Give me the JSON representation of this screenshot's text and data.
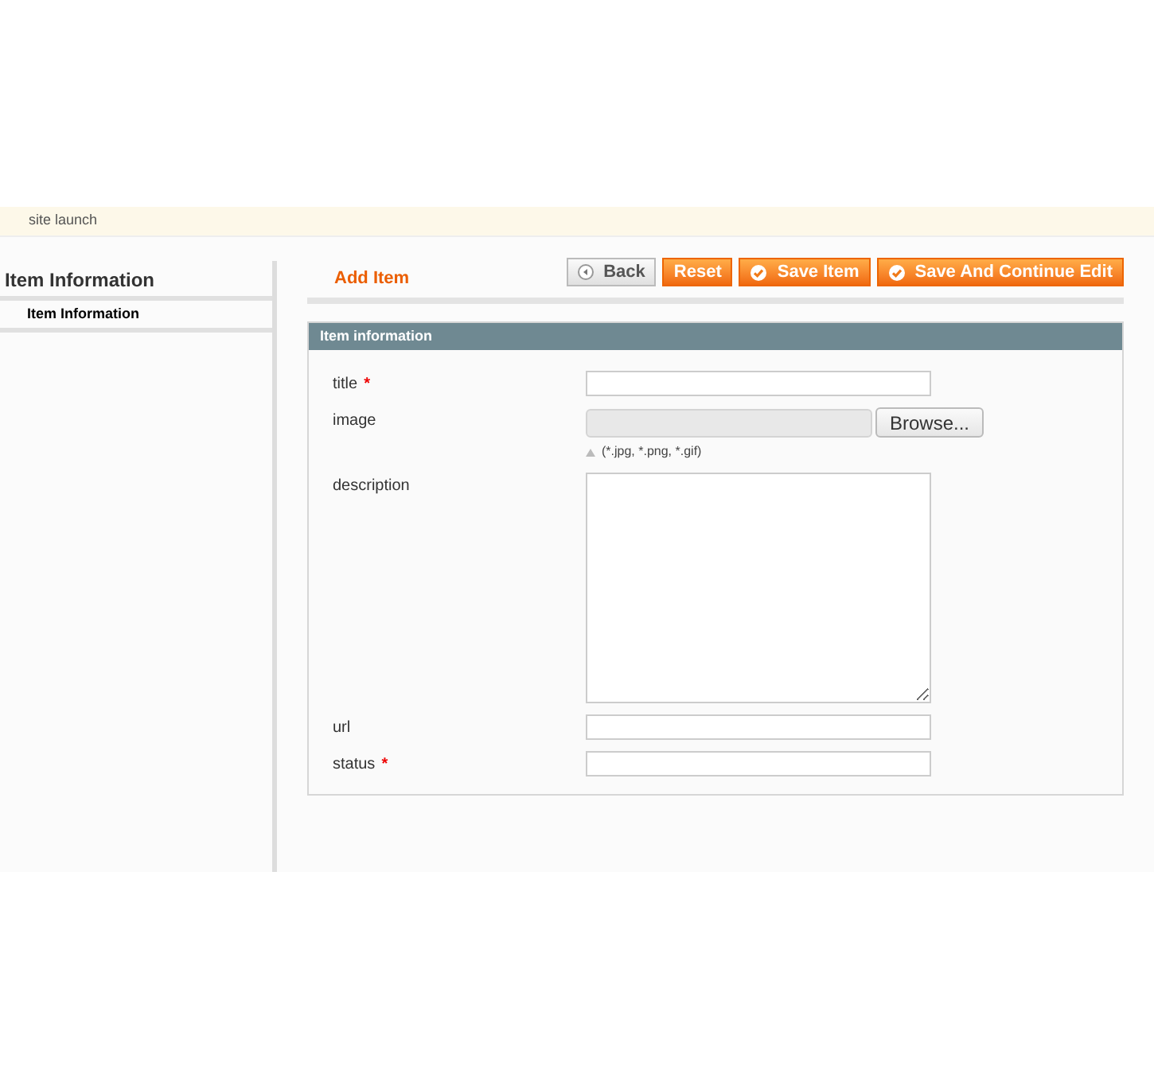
{
  "notice": {
    "text": "site launch"
  },
  "sidebar": {
    "title": "Item Information",
    "items": [
      {
        "label": "Item Information",
        "selected": true
      }
    ]
  },
  "page": {
    "title": "Add Item"
  },
  "buttons": [
    {
      "label": "Back",
      "kind": "back"
    },
    {
      "label": "Reset",
      "kind": "plain"
    },
    {
      "label": "Save Item",
      "kind": "save"
    },
    {
      "label": "Save And Continue Edit",
      "kind": "save"
    }
  ],
  "fieldset": {
    "title": "Item information",
    "required_symbol": "*",
    "fields": [
      {
        "label": "title",
        "kind": "text",
        "required": true
      },
      {
        "label": "image",
        "kind": "file",
        "required": false,
        "button": "Browse...",
        "hint": "(*.jpg, *.png, *.gif)"
      },
      {
        "label": "description",
        "kind": "textarea",
        "required": false
      },
      {
        "label": "url",
        "kind": "text",
        "required": false
      },
      {
        "label": "status",
        "kind": "text",
        "required": true
      }
    ]
  }
}
